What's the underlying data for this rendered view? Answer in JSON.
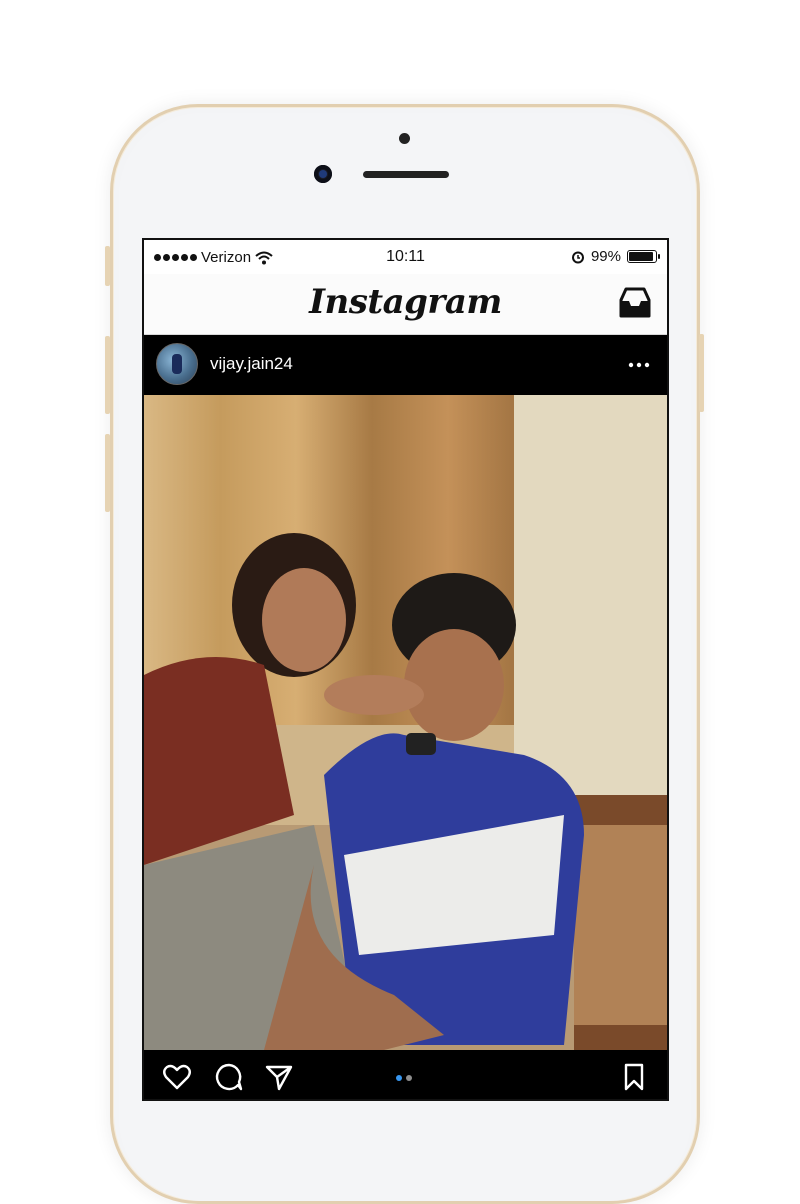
{
  "status_bar": {
    "carrier": "Verizon",
    "time": "10:11",
    "battery": "99%",
    "icons": [
      "signal-dots-icon",
      "wifi-icon",
      "alarm-icon",
      "battery-icon"
    ]
  },
  "nav": {
    "logo": "Instagram",
    "inbox_icon": "inbox-tray-icon"
  },
  "post": {
    "username": "vijay.jain24",
    "more_icon": "ellipsis-icon",
    "photo_description_icon": "post-photo",
    "carousel": {
      "total": 2,
      "current": 1,
      "active_color": "#3897f0",
      "inactive_color": "#8e8e8e"
    },
    "actions": [
      "heart-icon",
      "comment-icon",
      "share-icon",
      "bookmark-icon"
    ]
  },
  "colors": {
    "device_frame": "#e2cfb0",
    "screen_bg": "#000000",
    "nav_bg": "#fbfbfb"
  }
}
